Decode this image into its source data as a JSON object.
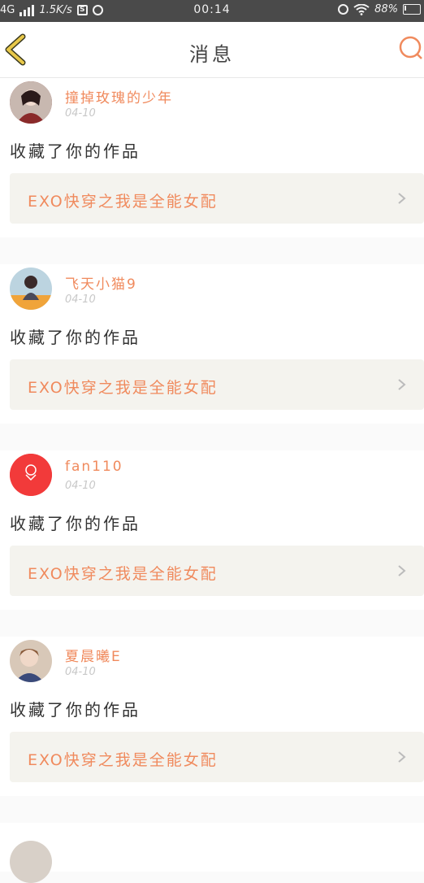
{
  "status_bar": {
    "network": "4G",
    "speed": "1.5K/s",
    "time": "00:14",
    "battery": "88%"
  },
  "header": {
    "title": "消息"
  },
  "messages": [
    {
      "username": "撞掉玫瑰的少年",
      "date": "04-10",
      "action": "收藏了你的作品",
      "work_title": "EXO快穿之我是全能女配",
      "avatar_color": "#8a3a3a"
    },
    {
      "username": "飞天小猫9",
      "date": "04-10",
      "action": "收藏了你的作品",
      "work_title": "EXO快穿之我是全能女配",
      "avatar_color": "#f0a43a"
    },
    {
      "username": "fan110",
      "date": "04-10",
      "action": "收藏了你的作品",
      "work_title": "EXO快穿之我是全能女配",
      "avatar_color": "#f23a3a"
    },
    {
      "username": "夏晨曦E",
      "date": "04-10",
      "action": "收藏了你的作品",
      "work_title": "EXO快穿之我是全能女配",
      "avatar_color": "#5a6a8a"
    }
  ],
  "colors": {
    "accent": "#f08a5d",
    "back_arrow": "#e8c84a",
    "card_box": "#f4f3ee"
  }
}
